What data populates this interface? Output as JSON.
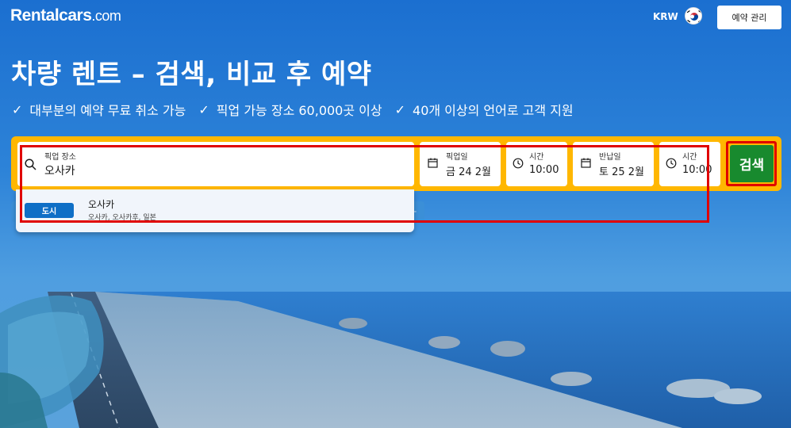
{
  "header": {
    "logo_main": "Rentalcars",
    "logo_suffix": ".com",
    "currency": "KRW",
    "flag_icon": "korea-flag-icon",
    "manage_booking": "예약 관리"
  },
  "hero": {
    "title": "차량 렌트 – 검색, 비교 후 예약",
    "features": [
      "대부분의 예약 무료 취소 가능",
      "픽업 가능 장소 60,000곳 이상",
      "40개 이상의 언어로 고객 지원"
    ]
  },
  "search": {
    "pickup_location_label": "픽업 장소",
    "pickup_location_value": "오사카",
    "pickup_date_label": "픽업일",
    "pickup_date_value": "금 24 2월",
    "pickup_time_label": "시간",
    "pickup_time_value": "10:00",
    "return_date_label": "반납일",
    "return_date_value": "토 25 2월",
    "return_time_label": "시간",
    "return_time_value": "10:00",
    "search_button": "검색"
  },
  "suggestion": {
    "badge": "도시",
    "title": "오사카",
    "subtitle": "오사카, 오사카후, 일본"
  },
  "colors": {
    "brand_blue": "#1b6fd0",
    "search_frame": "#ffb700",
    "search_button": "#188a2e",
    "highlight": "#e00000"
  }
}
